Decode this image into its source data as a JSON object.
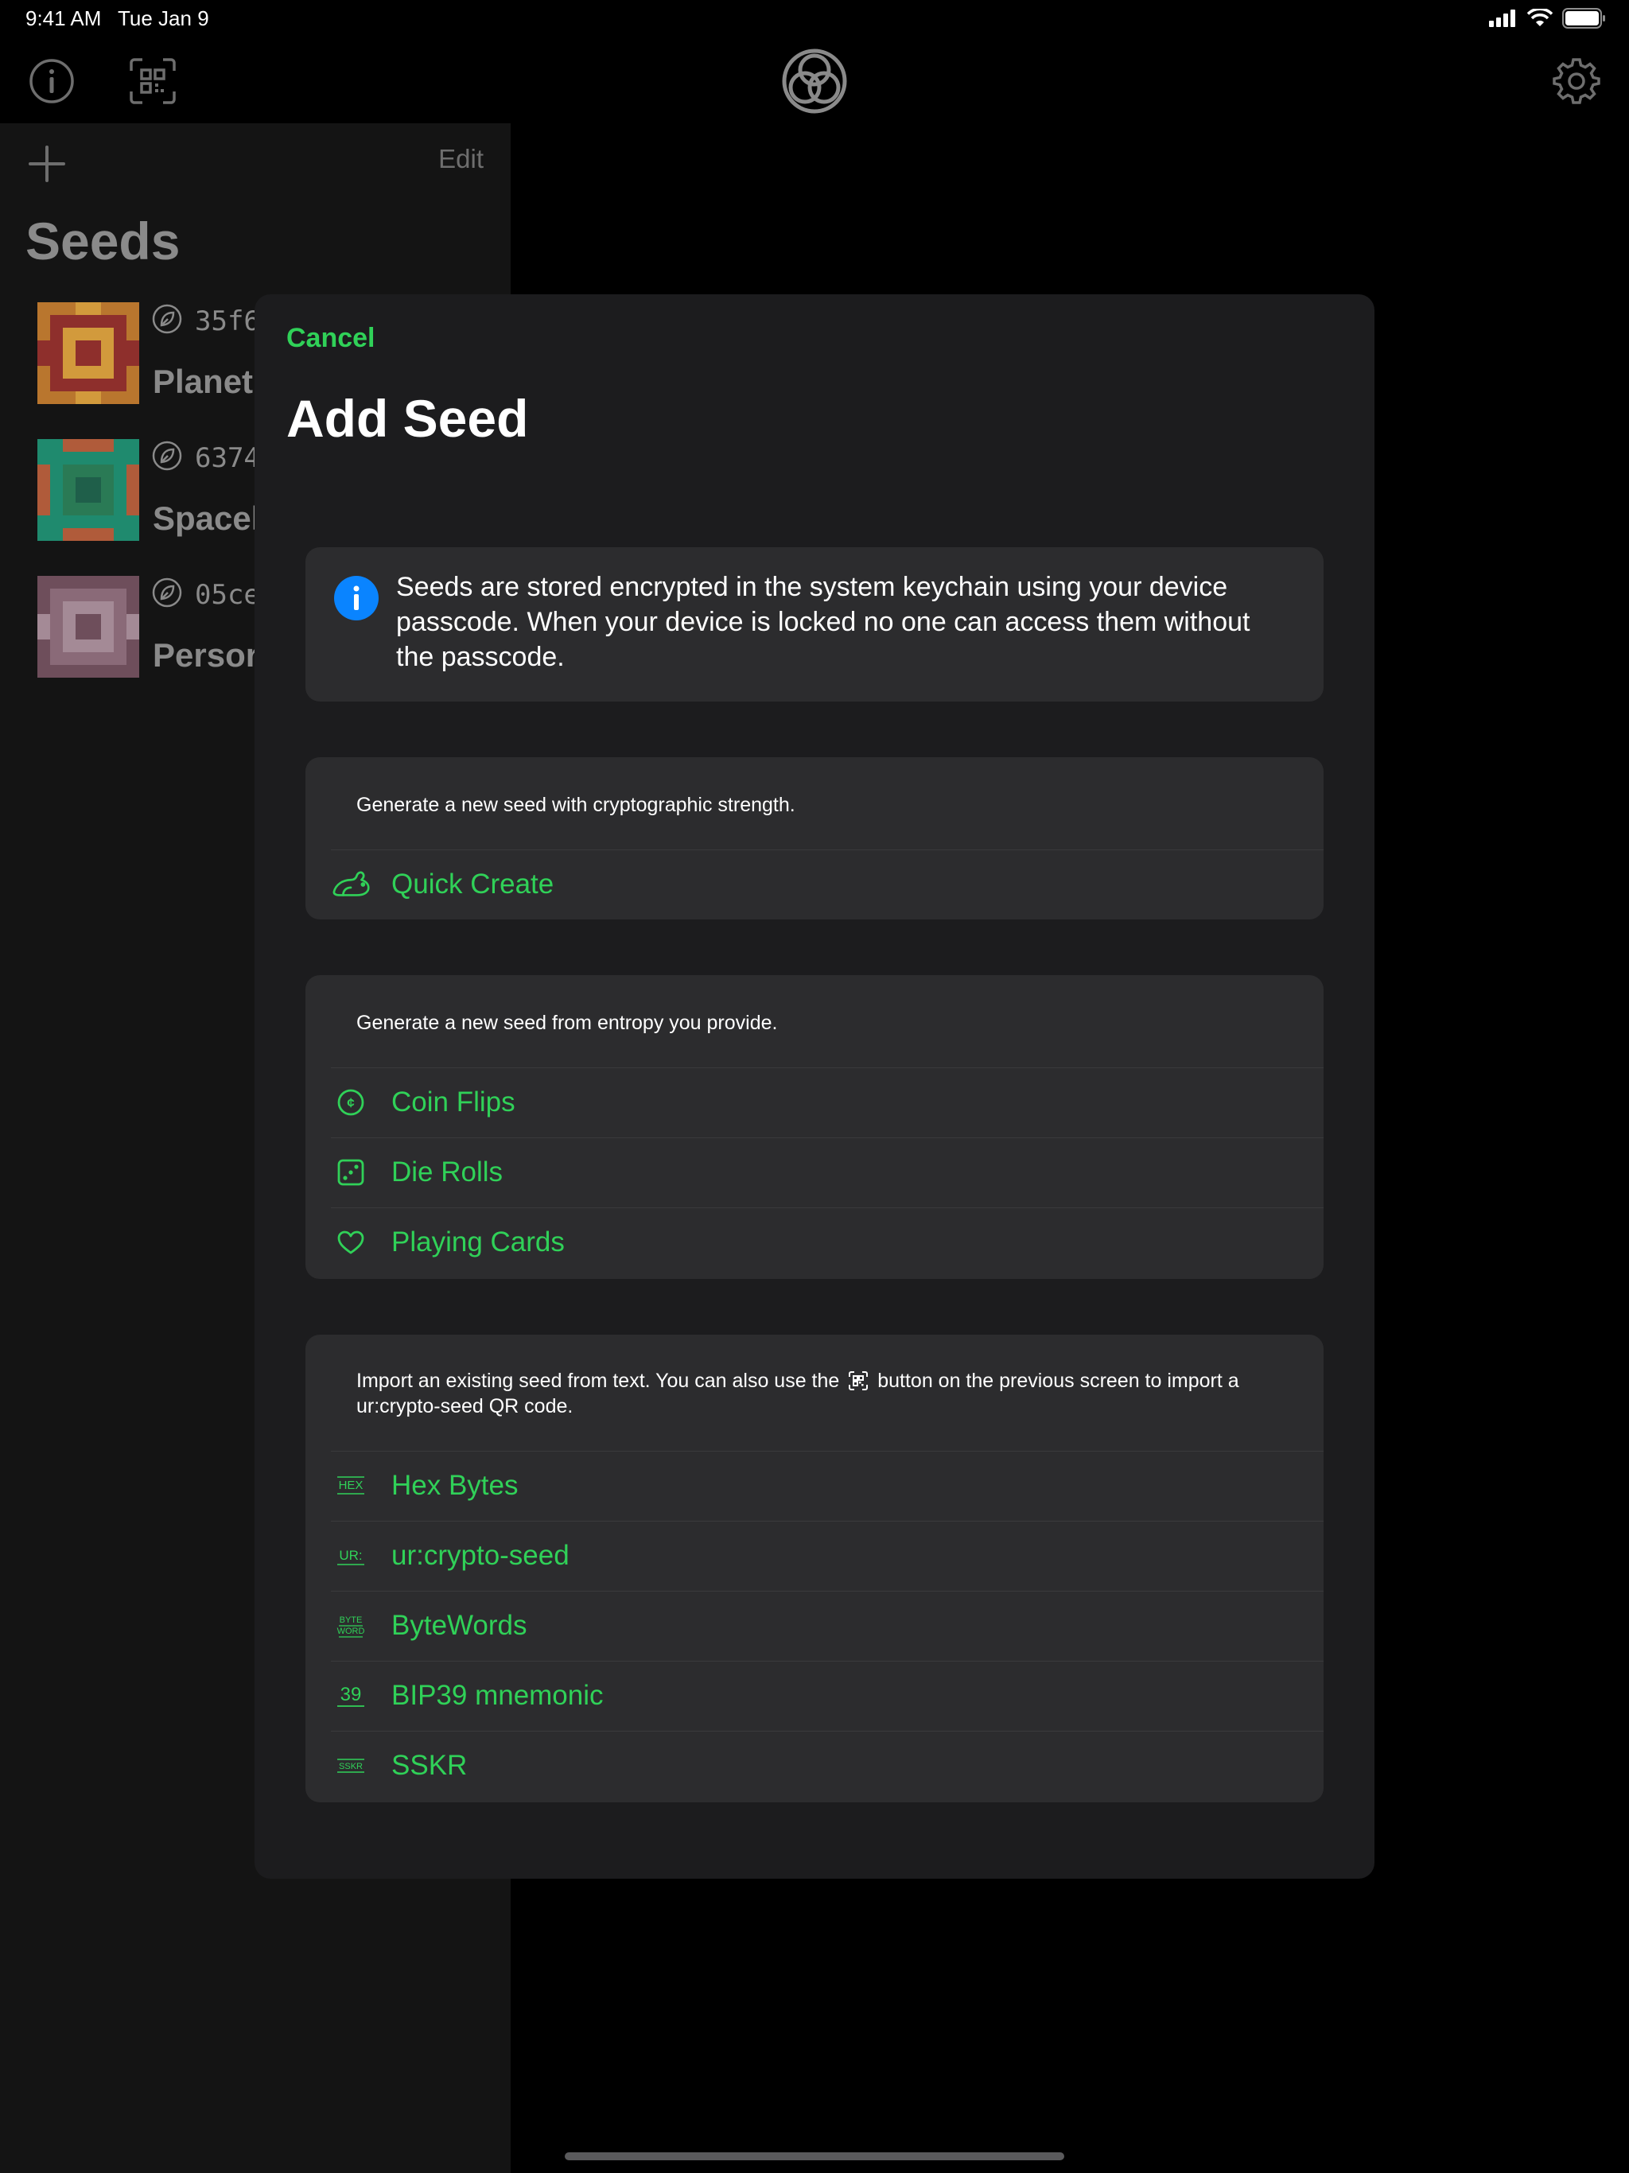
{
  "status_bar": {
    "time": "9:41 AM",
    "date": "Tue Jan 9"
  },
  "sidebar": {
    "edit_label": "Edit",
    "title": "Seeds",
    "seeds": [
      {
        "id": "35f6",
        "name": "Planet",
        "colors": [
          "#b9762e",
          "#8e2f2c",
          "#d29a3c"
        ]
      },
      {
        "id": "6374",
        "name": "Spacel",
        "colors": [
          "#1f8a6e",
          "#b05b3a",
          "#2a7a55"
        ]
      },
      {
        "id": "05ce",
        "name": "Persor",
        "colors": [
          "#6e4e5b",
          "#8a6a78",
          "#a48a96"
        ]
      }
    ]
  },
  "modal": {
    "cancel_label": "Cancel",
    "title": "Add Seed",
    "info_text": "Seeds are stored encrypted in the system keychain using your device passcode. When your device is locked no one can access them without the passcode.",
    "sections": [
      {
        "description": "Generate a new seed with cryptographic strength.",
        "items": [
          {
            "label": "Quick Create",
            "icon": "rabbit-icon"
          }
        ]
      },
      {
        "description": "Generate a new seed from entropy you provide.",
        "items": [
          {
            "label": "Coin Flips",
            "icon": "coin-icon"
          },
          {
            "label": "Die Rolls",
            "icon": "die-icon"
          },
          {
            "label": "Playing Cards",
            "icon": "heart-icon"
          }
        ]
      },
      {
        "description_part1": "Import an existing seed from text. You can also use the",
        "description_part2": "button on the previous screen to import a",
        "description_line2": "ur:crypto-seed QR code.",
        "items": [
          {
            "label": "Hex Bytes",
            "icon": "hex-icon",
            "icon_text": "HEX"
          },
          {
            "label": "ur:crypto-seed",
            "icon": "ur-icon",
            "icon_text": "UR:"
          },
          {
            "label": "ByteWords",
            "icon": "bytewords-icon",
            "icon_text_1": "BYTE",
            "icon_text_2": "WORD"
          },
          {
            "label": "BIP39 mnemonic",
            "icon": "bip39-icon",
            "icon_text": "39"
          },
          {
            "label": "SSKR",
            "icon": "sskr-icon",
            "icon_text": "SSKR"
          }
        ]
      }
    ]
  },
  "colors": {
    "accent": "#30d158",
    "info_blue": "#0a84ff",
    "card": "#2c2c2e",
    "modal": "#1c1c1e"
  }
}
